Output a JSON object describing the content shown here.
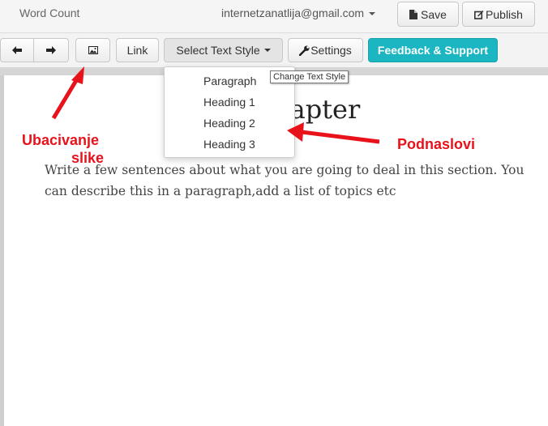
{
  "header": {
    "word_count": "Word Count",
    "email": "internetzanatlija@gmail.com",
    "save_label": "Save",
    "publish_label": "Publish"
  },
  "toolbar": {
    "link_label": "Link",
    "text_style_label": "Select Text Style",
    "settings_label": "Settings",
    "feedback_label": "Feedback & Support"
  },
  "dropdown": {
    "items": [
      "Paragraph",
      "Heading 1",
      "Heading 2",
      "Heading 3"
    ],
    "tooltip": "Change Text Style"
  },
  "document": {
    "title_visible": "hapter",
    "body": "Write a few sentences about what you are going to deal in this section. You can describe this in a paragraph,add a list of topics etc"
  },
  "annotations": {
    "image_insert_line1": "Ubacivanje",
    "image_insert_line2": "slike",
    "subheadings": "Podnaslovi"
  },
  "colors": {
    "feedback_button": "#1bb6c1",
    "annotation": "#e8121b"
  }
}
